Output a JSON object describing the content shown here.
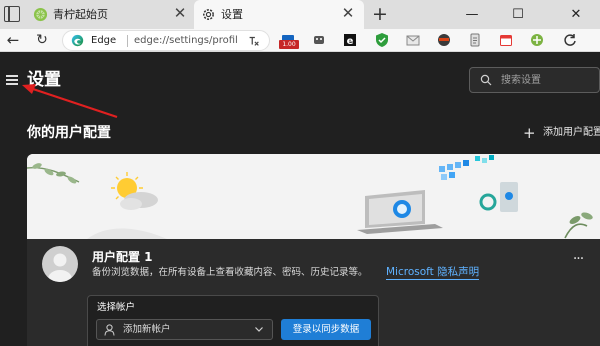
{
  "browser": {
    "tabs": [
      {
        "title": "青柠起始页",
        "active": false,
        "favicon": "lime-icon"
      },
      {
        "title": "设置",
        "active": true,
        "favicon": "gear-icon"
      }
    ],
    "new_tab_label": "+",
    "window_controls": {
      "minimize": "—",
      "maximize": "☐",
      "close": "✕"
    },
    "tab_close": "✕"
  },
  "toolbar": {
    "brand": "Edge",
    "url": "edge://settings/profiles",
    "extension_badge": "1.00",
    "extension_icons": [
      "tab-cube-icon",
      "cookie-icon",
      "e-letter-icon",
      "shield-icon",
      "envelope-icon",
      "ninja-icon",
      "document-icon",
      "calendar-icon",
      "puzzle-green-icon",
      "sync-icon"
    ]
  },
  "settings": {
    "page_title": "设置",
    "search_placeholder": "搜索设置",
    "section_title": "你的用户配置",
    "add_profile_label": "添加用户配置",
    "profile": {
      "name": "用户配置 1",
      "description": "备份浏览数据，在所有设备上查看收藏内容、密码、历史记录等。",
      "privacy_link": "Microsoft 隐私声明",
      "more": "···"
    },
    "account": {
      "label": "选择帐户",
      "select_value": "添加新帐户",
      "sync_button": "登录以同步数据"
    }
  },
  "colors": {
    "accent": "#1f7ed6",
    "link": "#5fb2ff",
    "annotation_arrow": "#e02020",
    "content_bg": "#202020"
  }
}
